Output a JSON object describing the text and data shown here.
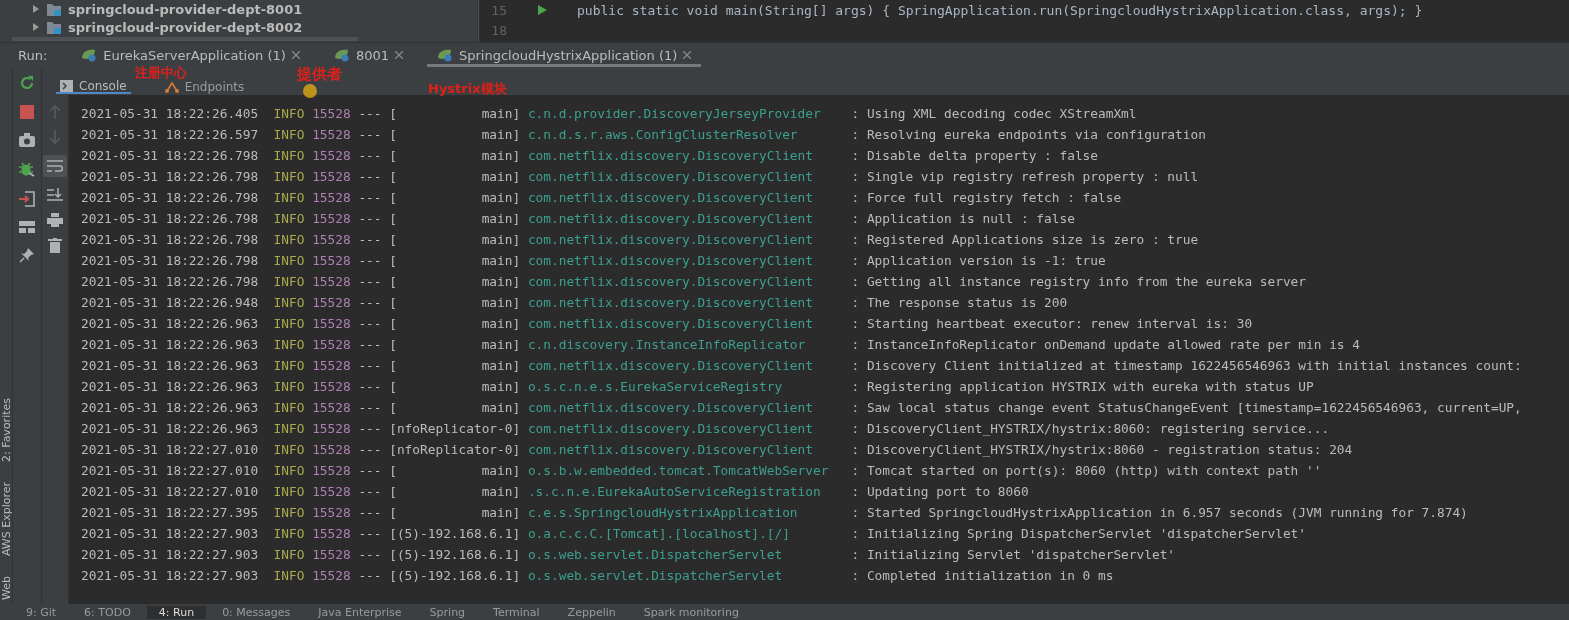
{
  "project_tree": [
    {
      "label": "springcloud-provider-dept-8001",
      "expanded": false
    },
    {
      "label": "springcloud-provider-dept-8002",
      "expanded": false
    }
  ],
  "editor": {
    "lines": [
      {
        "number": "15",
        "code": "public static void main(String[] args) { SpringApplication.run(SpringcloudHystrixApplication.class, args); }"
      },
      {
        "number": "18"
      }
    ]
  },
  "run_tabs": {
    "label": "Run:",
    "tabs": [
      {
        "label": "EurekaServerApplication (1)",
        "selected": false
      },
      {
        "label": "8001",
        "selected": false
      },
      {
        "label": "SpringcloudHystrixApplication (1)",
        "selected": true
      }
    ]
  },
  "console_tabs": [
    {
      "label": "Console",
      "selected": true
    },
    {
      "label": "Endpoints",
      "selected": false
    }
  ],
  "annotations": [
    "注册中心",
    "提供者",
    "Hystrix模块"
  ],
  "log": [
    {
      "time": "2021-05-31 18:22:26.405",
      "level": "INFO",
      "pid": "15528",
      "sep": "---",
      "thread": "[           main]",
      "logger": "c.n.d.provider.DiscoveryJerseyProvider",
      "message": ": Using XML decoding codec XStreamXml"
    },
    {
      "time": "2021-05-31 18:22:26.597",
      "level": "INFO",
      "pid": "15528",
      "sep": "---",
      "thread": "[           main]",
      "logger": "c.n.d.s.r.aws.ConfigClusterResolver",
      "message": ": Resolving eureka endpoints via configuration"
    },
    {
      "time": "2021-05-31 18:22:26.798",
      "level": "INFO",
      "pid": "15528",
      "sep": "---",
      "thread": "[           main]",
      "logger": "com.netflix.discovery.DiscoveryClient",
      "message": ": Disable delta property : false"
    },
    {
      "time": "2021-05-31 18:22:26.798",
      "level": "INFO",
      "pid": "15528",
      "sep": "---",
      "thread": "[           main]",
      "logger": "com.netflix.discovery.DiscoveryClient",
      "message": ": Single vip registry refresh property : null"
    },
    {
      "time": "2021-05-31 18:22:26.798",
      "level": "INFO",
      "pid": "15528",
      "sep": "---",
      "thread": "[           main]",
      "logger": "com.netflix.discovery.DiscoveryClient",
      "message": ": Force full registry fetch : false"
    },
    {
      "time": "2021-05-31 18:22:26.798",
      "level": "INFO",
      "pid": "15528",
      "sep": "---",
      "thread": "[           main]",
      "logger": "com.netflix.discovery.DiscoveryClient",
      "message": ": Application is null : false"
    },
    {
      "time": "2021-05-31 18:22:26.798",
      "level": "INFO",
      "pid": "15528",
      "sep": "---",
      "thread": "[           main]",
      "logger": "com.netflix.discovery.DiscoveryClient",
      "message": ": Registered Applications size is zero : true"
    },
    {
      "time": "2021-05-31 18:22:26.798",
      "level": "INFO",
      "pid": "15528",
      "sep": "---",
      "thread": "[           main]",
      "logger": "com.netflix.discovery.DiscoveryClient",
      "message": ": Application version is -1: true"
    },
    {
      "time": "2021-05-31 18:22:26.798",
      "level": "INFO",
      "pid": "15528",
      "sep": "---",
      "thread": "[           main]",
      "logger": "com.netflix.discovery.DiscoveryClient",
      "message": ": Getting all instance registry info from the eureka server"
    },
    {
      "time": "2021-05-31 18:22:26.948",
      "level": "INFO",
      "pid": "15528",
      "sep": "---",
      "thread": "[           main]",
      "logger": "com.netflix.discovery.DiscoveryClient",
      "message": ": The response status is 200"
    },
    {
      "time": "2021-05-31 18:22:26.963",
      "level": "INFO",
      "pid": "15528",
      "sep": "---",
      "thread": "[           main]",
      "logger": "com.netflix.discovery.DiscoveryClient",
      "message": ": Starting heartbeat executor: renew interval is: 30"
    },
    {
      "time": "2021-05-31 18:22:26.963",
      "level": "INFO",
      "pid": "15528",
      "sep": "---",
      "thread": "[           main]",
      "logger": "c.n.discovery.InstanceInfoReplicator",
      "message": ": InstanceInfoReplicator onDemand update allowed rate per min is 4"
    },
    {
      "time": "2021-05-31 18:22:26.963",
      "level": "INFO",
      "pid": "15528",
      "sep": "---",
      "thread": "[           main]",
      "logger": "com.netflix.discovery.DiscoveryClient",
      "message": ": Discovery Client initialized at timestamp 1622456546963 with initial instances count:"
    },
    {
      "time": "2021-05-31 18:22:26.963",
      "level": "INFO",
      "pid": "15528",
      "sep": "---",
      "thread": "[           main]",
      "logger": "o.s.c.n.e.s.EurekaServiceRegistry",
      "message": ": Registering application HYSTRIX with eureka with status UP"
    },
    {
      "time": "2021-05-31 18:22:26.963",
      "level": "INFO",
      "pid": "15528",
      "sep": "---",
      "thread": "[           main]",
      "logger": "com.netflix.discovery.DiscoveryClient",
      "message": ": Saw local status change event StatusChangeEvent [timestamp=1622456546963, current=UP,"
    },
    {
      "time": "2021-05-31 18:22:26.963",
      "level": "INFO",
      "pid": "15528",
      "sep": "---",
      "thread": "[nfoReplicator-0]",
      "logger": "com.netflix.discovery.DiscoveryClient",
      "message": ": DiscoveryClient_HYSTRIX/hystrix:8060: registering service..."
    },
    {
      "time": "2021-05-31 18:22:27.010",
      "level": "INFO",
      "pid": "15528",
      "sep": "---",
      "thread": "[nfoReplicator-0]",
      "logger": "com.netflix.discovery.DiscoveryClient",
      "message": ": DiscoveryClient_HYSTRIX/hystrix:8060 - registration status: 204"
    },
    {
      "time": "2021-05-31 18:22:27.010",
      "level": "INFO",
      "pid": "15528",
      "sep": "---",
      "thread": "[           main]",
      "logger": "o.s.b.w.embedded.tomcat.TomcatWebServer",
      "message": ": Tomcat started on port(s): 8060 (http) with context path ''"
    },
    {
      "time": "2021-05-31 18:22:27.010",
      "level": "INFO",
      "pid": "15528",
      "sep": "---",
      "thread": "[           main]",
      "logger": ".s.c.n.e.EurekaAutoServiceRegistration",
      "message": ": Updating port to 8060"
    },
    {
      "time": "2021-05-31 18:22:27.395",
      "level": "INFO",
      "pid": "15528",
      "sep": "---",
      "thread": "[           main]",
      "logger": "c.e.s.SpringcloudHystrixApplication",
      "message": ": Started SpringcloudHystrixApplication in 6.957 seconds (JVM running for 7.874)"
    },
    {
      "time": "2021-05-31 18:22:27.903",
      "level": "INFO",
      "pid": "15528",
      "sep": "---",
      "thread": "[(5)-192.168.6.1]",
      "logger": "o.a.c.c.C.[Tomcat].[localhost].[/]",
      "message": ": Initializing Spring DispatcherServlet 'dispatcherServlet'"
    },
    {
      "time": "2021-05-31 18:22:27.903",
      "level": "INFO",
      "pid": "15528",
      "sep": "---",
      "thread": "[(5)-192.168.6.1]",
      "logger": "o.s.web.servlet.DispatcherServlet",
      "message": ": Initializing Servlet 'dispatcherServlet'"
    },
    {
      "time": "2021-05-31 18:22:27.903",
      "level": "INFO",
      "pid": "15528",
      "sep": "---",
      "thread": "[(5)-192.168.6.1]",
      "logger": "o.s.web.servlet.DispatcherServlet",
      "message": ": Completed initialization in 0 ms"
    }
  ],
  "side_tool_windows": [
    "2: Favorites",
    "AWS Explorer",
    "Web"
  ],
  "bottom_tool_windows": [
    {
      "label": "9: Git",
      "selected": false
    },
    {
      "label": "6: TODO",
      "selected": false
    },
    {
      "label": "4: Run",
      "selected": true
    },
    {
      "label": "0: Messages",
      "selected": false
    },
    {
      "label": "Java Enterprise",
      "selected": false
    },
    {
      "label": "Spring",
      "selected": false
    },
    {
      "label": "Terminal",
      "selected": false
    },
    {
      "label": "Zeppelin",
      "selected": false
    },
    {
      "label": "Spark monitoring",
      "selected": false
    }
  ]
}
